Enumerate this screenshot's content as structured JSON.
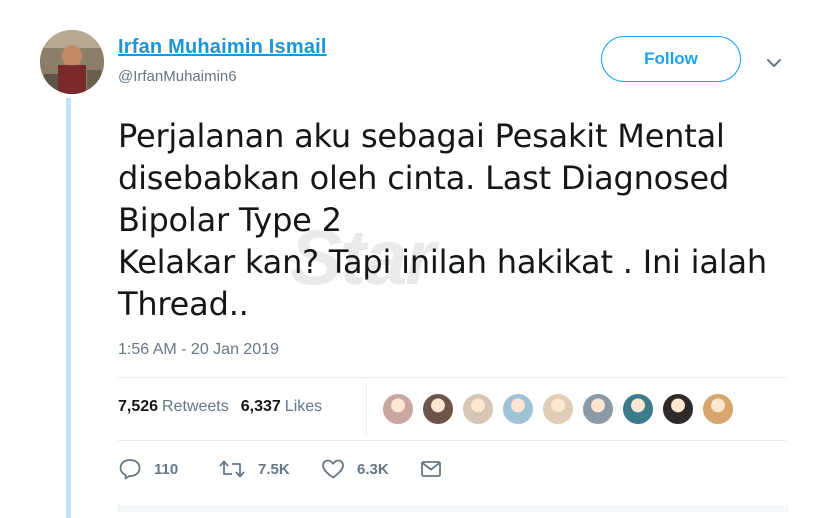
{
  "author": {
    "name": "Irfan Muhaimin Ismail",
    "handle": "@IrfanMuhaimin6"
  },
  "follow_label": "Follow",
  "tweet": {
    "text": "Perjalanan aku sebagai Pesakit Mental\ndisebabkan oleh cinta. Last Diagnosed\nBipolar Type 2\nKelakar kan? Tapi inilah hakikat . Ini ialah\nThread..",
    "timestamp": "1:56 AM - 20 Jan 2019"
  },
  "watermark": "Star",
  "stats": {
    "retweets_count": "7,526",
    "retweets_label": "Retweets",
    "likes_count": "6,337",
    "likes_label": "Likes"
  },
  "likers": [
    {
      "name": "liker-1",
      "color": "#c9a7a0"
    },
    {
      "name": "liker-2",
      "color": "#6e5448"
    },
    {
      "name": "liker-3",
      "color": "#d8c6b4"
    },
    {
      "name": "liker-4",
      "color": "#9fc3d6"
    },
    {
      "name": "liker-5",
      "color": "#e0cdb5"
    },
    {
      "name": "liker-6",
      "color": "#8a9aa6"
    },
    {
      "name": "liker-7",
      "color": "#3c7a8c"
    },
    {
      "name": "liker-8",
      "color": "#2f2a2a"
    },
    {
      "name": "liker-9",
      "color": "#d7a66c"
    }
  ],
  "actions": {
    "replies": "110",
    "retweets": "7.5K",
    "likes": "6.3K"
  },
  "colors": {
    "accent": "#1da1f2",
    "link": "#1b95e0",
    "muted": "#657786",
    "thread_line": "#c4e3f5"
  }
}
